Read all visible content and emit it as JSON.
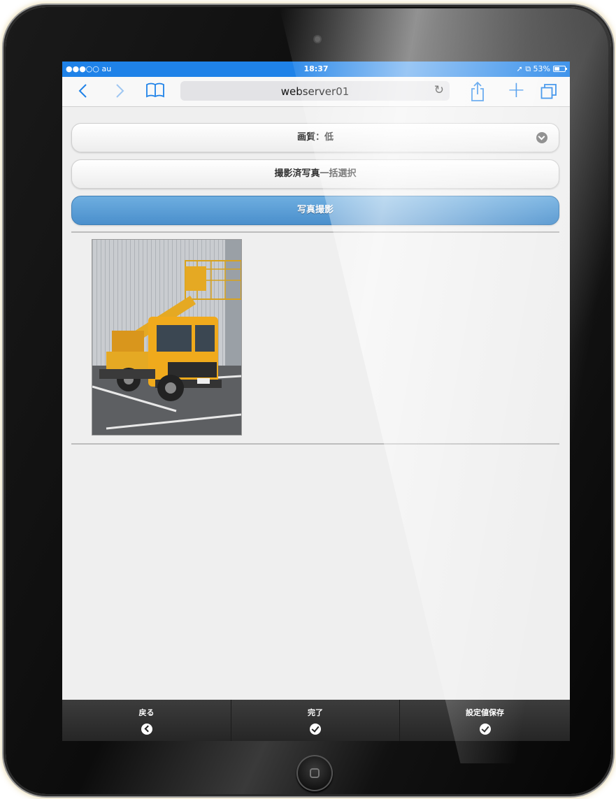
{
  "status_bar": {
    "carrier": "●●●○○ au",
    "wifi_icon": "wifi-icon",
    "time": "18:37",
    "right": "➚ ⧉ 53%",
    "battery_level": 0.53
  },
  "browser": {
    "url": "webserver01",
    "icons": [
      "back-icon",
      "forward-icon",
      "bookmarks-icon",
      "reload-icon",
      "share-icon",
      "add-tab-icon",
      "tabs-icon"
    ]
  },
  "controls": {
    "quality_label": "画質：低",
    "select_all_label": "撮影済写真一括選択",
    "take_photo_label": "写真撮影"
  },
  "photos": [
    {
      "subject": "orange aerial work truck"
    }
  ],
  "footer": {
    "back_label": "戻る",
    "done_label": "完了",
    "save_settings_label": "設定値保存"
  },
  "colors": {
    "status_bar": "#1f82e8",
    "accent_button": "#5b9fd6",
    "footer": "#2e2e2e"
  }
}
